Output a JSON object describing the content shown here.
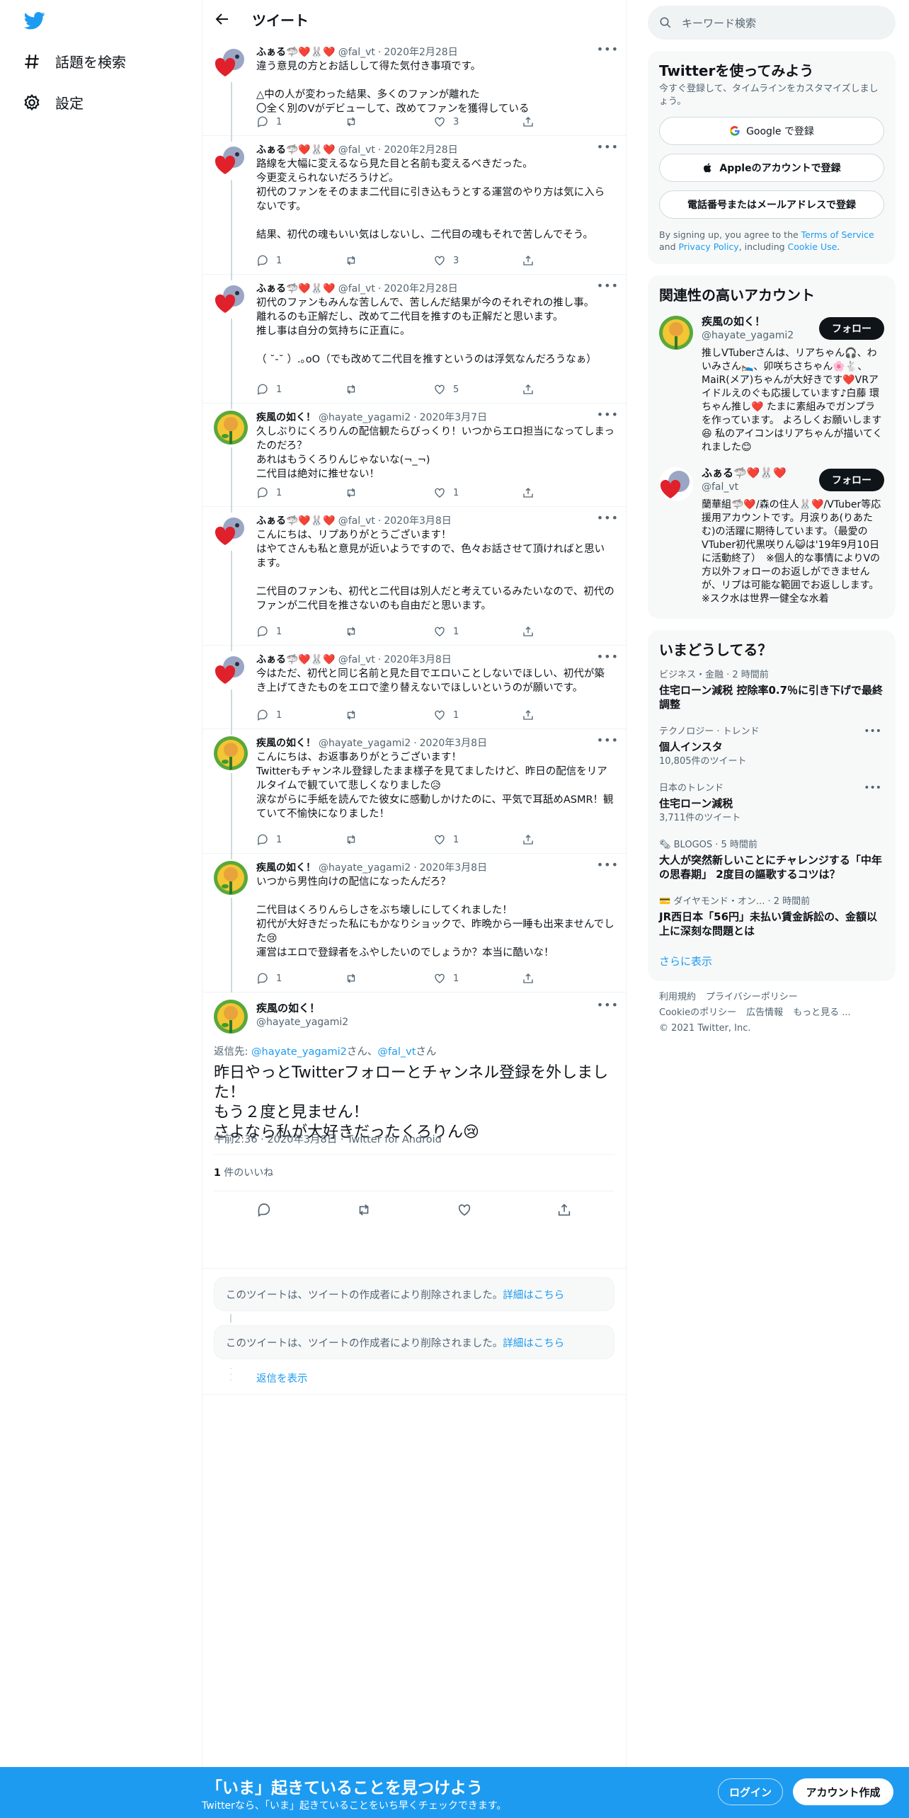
{
  "colors": {
    "accent": "#1d9bf0",
    "text": "#0f1419",
    "muted": "#536471",
    "border": "#eff3f4",
    "bg_secondary": "#f7f9f9"
  },
  "nav": {
    "logo_icon": "twitter-bird-icon",
    "explore_label": "話題を検索",
    "settings_label": "設定"
  },
  "header": {
    "title": "ツイート"
  },
  "tweets": [
    {
      "name": "ふぁる🦈❤️🐰❤️",
      "handle": "@fal_vt",
      "date": "2020年2月28日",
      "text": "違う意見の方とお話しして得た気付き事項です。\n\n△中の人が変わった結果、多くのファンが離れた\n〇全く別のVがデビューして、改めてファンを獲得している",
      "reply": "1",
      "retweet": "",
      "like": "3"
    },
    {
      "name": "ふぁる🦈❤️🐰❤️",
      "handle": "@fal_vt",
      "date": "2020年2月28日",
      "text": "路線を大幅に変えるなら見た目と名前も変えるべきだった。\n今更変えられないだろうけど。\n初代のファンをそのまま二代目に引き込もうとする運営のやり方は気に入らないです。\n\n結果、初代の魂もいい気はしないし、二代目の魂もそれで苦しんでそう。",
      "reply": "1",
      "retweet": "",
      "like": "3"
    },
    {
      "name": "ふぁる🦈❤️🐰❤️",
      "handle": "@fal_vt",
      "date": "2020年2月28日",
      "text": "初代のファンもみんな苦しんで、苦しんだ結果が今のそれぞれの推し事。\n離れるのも正解だし、改めて二代目を推すのも正解だと思います。\n推し事は自分の気持ちに正直に。\n\n（ ˘-˘ ）.｡oO（でも改めて二代目を推すというのは浮気なんだろうなぁ）",
      "reply": "1",
      "retweet": "",
      "like": "5"
    },
    {
      "name": "疾風の如く！",
      "handle": "@hayate_yagami2",
      "date": "2020年3月7日",
      "text": "久しぶりにくろりんの配信観たらびっくり！いつからエロ担当になってしまったのだろ？\nあれはもうくろりんじゃないな(¬_¬)\n二代目は絶対に推せない！",
      "reply": "1",
      "retweet": "",
      "like": "1"
    },
    {
      "name": "ふぁる🦈❤️🐰❤️",
      "handle": "@fal_vt",
      "date": "2020年3月8日",
      "text": "こんにちは、リプありがとうございます！\nはやてさんも私と意見が近いようですので、色々お話させて頂ければと思います。\n\n二代目のファンも、初代と二代目は別人だと考えているみたいなので、初代のファンが二代目を推さないのも自由だと思います。",
      "reply": "1",
      "retweet": "",
      "like": "1"
    },
    {
      "name": "ふぁる🦈❤️🐰❤️",
      "handle": "@fal_vt",
      "date": "2020年3月8日",
      "text": "今はただ、初代と同じ名前と見た目でエロいことしないでほしい、初代が築き上げてきたものをエロで塗り替えないでほしいというのが願いです。",
      "reply": "1",
      "retweet": "",
      "like": "1"
    },
    {
      "name": "疾風の如く！",
      "handle": "@hayate_yagami2",
      "date": "2020年3月8日",
      "text": "こんにちは、お返事ありがとうございます！\nTwitterもチャンネル登録したまま様子を見てましたけど、昨日の配信をリアルタイムで観ていて悲しくなりました😥\n涙ながらに手紙を読んでた彼女に感動しかけたのに、平気で耳舐めASMR！観ていて不愉快になりました！",
      "reply": "1",
      "retweet": "",
      "like": "1"
    },
    {
      "name": "疾風の如く！",
      "handle": "@hayate_yagami2",
      "date": "2020年3月8日",
      "text": "いつから男性向けの配信になったんだろ？\n\n二代目はくろりんらしさをぶち壊しにしてくれました！\n初代が大好きだった私にもかなりショックで、昨晩から一睡も出来ませんでした😢\n運営はエロで登録者をふやしたいのでしょうか？本当に酷いな！",
      "reply": "1",
      "retweet": "",
      "like": "1"
    }
  ],
  "focus": {
    "name": "疾風の如く！",
    "handle": "@hayate_yagami2",
    "reply_prefix": "返信先: ",
    "reply_to_1": "@hayate_yagami2",
    "san1": "さん、",
    "reply_to_2": "@fal_vt",
    "san2": "さん",
    "text": "昨日やっとTwitterフォローとチャンネル登録を外しました！\nもう２度と見ません！\nさよなら私が大好きだったくろりん😢",
    "meta": "午前2:36 · 2020年3月8日 · Twitter for Android",
    "likes_count": "1",
    "likes_label": "件のいいね"
  },
  "deleted": [
    {
      "text": "このツイートは、ツイートの作成者により削除されました。",
      "link": "詳細はこちら"
    },
    {
      "text": "このツイートは、ツイートの作成者により削除されました。",
      "link": "詳細はこちら"
    }
  ],
  "show_replies": "返信を表示",
  "right": {
    "search_placeholder": "キーワード検索",
    "signup": {
      "title": "Twitterを使ってみよう",
      "subtitle": "今すぐ登録して、タイムラインをカスタマイズしましょう。",
      "google": "Google で登録",
      "apple": "Appleのアカウントで登録",
      "phone": "電話番号またはメールアドレスで登録",
      "terms_pre": "By signing up, you agree to the ",
      "terms": "Terms of Service",
      "and": " and ",
      "privacy": "Privacy Policy",
      "incl": ", including ",
      "cookie": "Cookie Use",
      "end": "."
    },
    "relevant": {
      "title": "関連性の高いアカウント",
      "accounts": [
        {
          "name": "疾風の如く！",
          "handle": "@hayate_yagami2",
          "bio": "推しVTuberさんは、リアちゃん🎧、わいみさん🛌、卯咲ちさちゃん🌸🐇、MaiR(メア)ちゃんが大好きです❤️VRアイドルえのぐも応援しています♪白藤 環ちゃん推し❤️ たまに素組みでガンプラを作っています。 よろしくお願いします😆 私のアイコンはリアちゃんが描いてくれました😊",
          "follow": "フォロー"
        },
        {
          "name": "ふぁる🦈❤️🐰❤️",
          "handle": "@fal_vt",
          "bio": "蘭華組🦈❤️/森の住人🐰❤️/VTuber等応援用アカウントです。月涙りあ(りあたむ)の活躍に期待しています。（最愛のVTuber初代黒咲りん😺は'19年9月10日に活動終了）　※個人的な事情によりVの方以外フォローのお返しができませんが、リプは可能な範囲でお返しします。 ※スク水は世界一健全な水着",
          "follow": "フォロー"
        }
      ]
    },
    "trends": {
      "title": "いまどうしてる？",
      "items": [
        {
          "context": "ビジネス・金融 · 2 時間前",
          "title": "住宅ローン減税 控除率0.7％に引き下げで最終調整",
          "count": "",
          "more": false
        },
        {
          "context": "テクノロジー · トレンド",
          "title": "個人インスタ",
          "count": "10,805件のツイート",
          "more": true
        },
        {
          "context": "日本のトレンド",
          "title": "住宅ローン減税",
          "count": "3,711件のツイート",
          "more": true
        },
        {
          "context": "🗞 BLOGOS · 5 時間前",
          "title": "大人が突然新しいことにチャレンジする「中年の思春期」 2度目の謳歌するコツは？",
          "count": "",
          "more": false
        },
        {
          "context": "💳 ダイヤモンド・オン... · 2 時間前",
          "title": "JR西日本「56円」未払い賃金訴訟の、金額以上に深刻な問題とは",
          "count": "",
          "more": false
        }
      ],
      "show_more": "さらに表示"
    },
    "footer": {
      "terms": "利用規約",
      "privacy": "プライバシーポリシー",
      "cookie": "Cookieのポリシー",
      "ads": "広告情報",
      "more": "もっと見る ...",
      "copyright": "© 2021 Twitter, Inc."
    }
  },
  "bottom": {
    "title": "「いま」起きていることを見つけよう",
    "subtitle": "Twitterなら、「いま」起きていることをいち早くチェックできます。",
    "login": "ログイン",
    "signup": "アカウント作成"
  }
}
